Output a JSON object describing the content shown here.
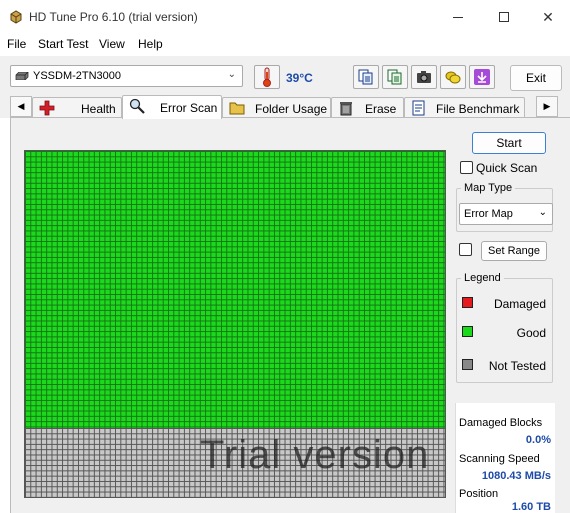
{
  "window": {
    "title": "HD Tune Pro 6.10 (trial version)",
    "minimize_glyph": "",
    "close_glyph": "✕"
  },
  "menu": [
    "File",
    "Start Test",
    "View",
    "Help"
  ],
  "toolbar": {
    "drive": "YSSDM-2TN3000",
    "temperature": "39°C",
    "exit_label": "Exit",
    "icons": [
      "copy-icon",
      "copy-all-icon",
      "camera-icon",
      "save-icon",
      "download-icon"
    ]
  },
  "tabs": [
    {
      "label": "Health",
      "icon": "health-cross-icon"
    },
    {
      "label": "Error Scan",
      "icon": "magnifier-icon"
    },
    {
      "label": "Folder Usage",
      "icon": "folder-icon"
    },
    {
      "label": "Erase",
      "icon": "trash-icon"
    },
    {
      "label": "File Benchmark",
      "icon": "file-benchmark-icon"
    }
  ],
  "error_scan": {
    "start_label": "Start",
    "quick_scan_label": "Quick Scan",
    "map_type_title": "Map Type",
    "map_type_value": "Error Map",
    "set_range_label": "Set Range",
    "legend_title": "Legend",
    "legend": [
      {
        "label": "Damaged",
        "color": "#e8191c"
      },
      {
        "label": "Good",
        "color": "#1bd91b"
      },
      {
        "label": "Not Tested",
        "color": "#888888"
      }
    ],
    "watermark": "Trial version",
    "progress_fraction_scanned": 0.8,
    "damaged_blocks_label": "Damaged Blocks",
    "damaged_blocks_value": "0.0%",
    "scanning_speed_label": "Scanning Speed",
    "scanning_speed_value": "1080.43 MB/s",
    "position_label": "Position",
    "position_value": "1.60 TB"
  },
  "colors": {
    "good": "#1bd91b",
    "damaged": "#e8191c",
    "not_tested": "#888888",
    "value_blue": "#1e4ba8"
  }
}
